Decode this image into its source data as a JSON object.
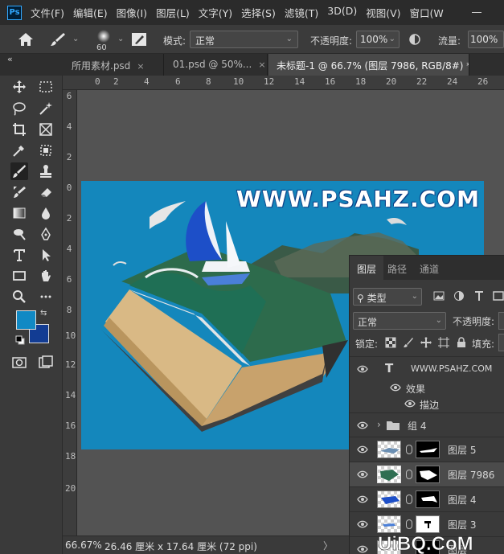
{
  "app": {
    "logo_text": "Ps"
  },
  "menu": [
    "文件(F)",
    "编辑(E)",
    "图像(I)",
    "图层(L)",
    "文字(Y)",
    "选择(S)",
    "滤镜(T)",
    "3D(D)",
    "视图(V)",
    "窗口(W"
  ],
  "options": {
    "brush_size": "60",
    "mode_label": "模式:",
    "mode_value": "正常",
    "opacity_label": "不透明度:",
    "opacity_value": "100%",
    "flow_label": "流量:",
    "flow_value": "100%"
  },
  "tabs": [
    {
      "label": "所用素材.psd",
      "close": "×"
    },
    {
      "label": "01.psd @ 50%...",
      "close": "×"
    },
    {
      "label": "未标题-1 @ 66.7% (图层 7986, RGB/8#) *",
      "close": "×"
    }
  ],
  "tabbar": {
    "collapse_glyph": "«"
  },
  "ruler_top": [
    "0",
    "2",
    "4",
    "6",
    "8",
    "10",
    "12",
    "14",
    "16",
    "18",
    "20",
    "22",
    "24",
    "26"
  ],
  "ruler_left": [
    "6",
    "4",
    "2",
    "0",
    "2",
    "4",
    "6",
    "8",
    "10",
    "12",
    "14",
    "16",
    "18",
    "20"
  ],
  "canvas": {
    "watermark_text": "WWW.PSAHZ.COM",
    "background_color": "#1487bc"
  },
  "colors": {
    "foreground": "#1189c4",
    "background": "#123c93",
    "swap_glyph": "⇆"
  },
  "layers_panel": {
    "tabs": [
      "图层",
      "路径",
      "通道"
    ],
    "filter_value": "类型",
    "blend_value": "正常",
    "opacity_label": "不透明度:",
    "lock_label": "锁定:",
    "fill_label": "填充:",
    "layers": [
      {
        "kind": "text",
        "name": "WWW.PSAHZ.COM",
        "effects_label": "效果",
        "effect": "描边"
      },
      {
        "kind": "group",
        "name": "组 4"
      },
      {
        "kind": "pixel",
        "name": "图层 5"
      },
      {
        "kind": "pixel",
        "name": "图层 7986",
        "selected": true
      },
      {
        "kind": "pixel",
        "name": "图层 4"
      },
      {
        "kind": "pixel",
        "name": "图层 3"
      },
      {
        "kind": "pixel",
        "name": "图层"
      }
    ]
  },
  "status": {
    "zoom": "66.67%",
    "doc_info": "26.46 厘米 x 17.64 厘米 (72 ppi)",
    "chevron": "〉"
  },
  "watermark_logo": "UiBQ.CoM"
}
